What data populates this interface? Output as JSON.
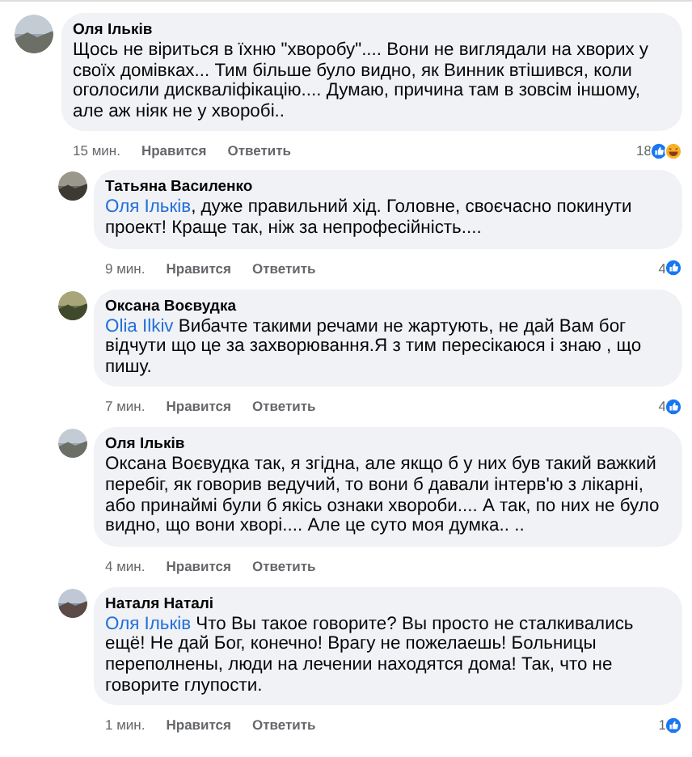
{
  "comments": [
    {
      "author": "Оля Ільків",
      "avatar": {
        "kind": "picture"
      },
      "text": "Щось не віриться в їхню \"хворобу\".... Вони не виглядали на хворих у своїх домівках... Тим більше було видно, як Винник втішився, коли оголосили дискваліфікацію.... Думаю, причина там в зовсім іншому, але аж ніяк не у хворобі..",
      "time": "15 мин.",
      "like": "Нравится",
      "reply": "Ответить",
      "reaction_count": "18",
      "reactions": [
        {
          "kind": "like"
        },
        {
          "kind": "haha"
        }
      ],
      "replies": [
        {
          "author": "Татьяна Василенко",
          "avatar": {
            "kind": "picture"
          },
          "mention": "Оля Ільків",
          "text": ", дуже правильний хід. Головне, своєчасно покинути проект!  Краще так, ніж за непрофесійність....",
          "time": "9 мин.",
          "like": "Нравится",
          "reply": "Ответить",
          "reaction_count": "4",
          "reactions": [
            {
              "kind": "like"
            }
          ]
        },
        {
          "author": "Оксана Воєвудка",
          "avatar": {
            "kind": "picture"
          },
          "mention": "Olia Ilkiv",
          "text": " Вибачте такими речами не жартують, не дай Вам бог відчути що це за захворювання.Я з тим пересікаюся і знаю , що пишу.",
          "time": "7 мин.",
          "like": "Нравится",
          "reply": "Ответить",
          "reaction_count": "4",
          "reactions": [
            {
              "kind": "like"
            }
          ]
        },
        {
          "author": "Оля Ільків",
          "avatar": {
            "kind": "picture"
          },
          "text": "Оксана Воєвудка так, я згідна, але якщо б у них був такий важкий перебіг, як говорив ведучий, то вони б давали інтерв'ю з лікарні, або принаймі були б якісь ознаки хвороби.... А так, по них не було видно, що вони хворі.... Але це суто моя думка.. ..",
          "time": "4 мин.",
          "like": "Нравится",
          "reply": "Ответить"
        },
        {
          "author": "Наталя Наталі",
          "avatar": {
            "kind": "picture"
          },
          "mention": "Оля Ільків",
          "text": " Что Вы такое говорите? Вы просто не сталкивались ещё! Не дай Бог, конечно! Врагу не пожелаешь! Больницы переполнены, люди на лечении находятся дома! Так, что не говорите глупости.",
          "time": "1 мин.",
          "like": "Нравится",
          "reply": "Ответить",
          "reaction_count": "1",
          "reactions": [
            {
              "kind": "like"
            }
          ]
        }
      ]
    }
  ]
}
